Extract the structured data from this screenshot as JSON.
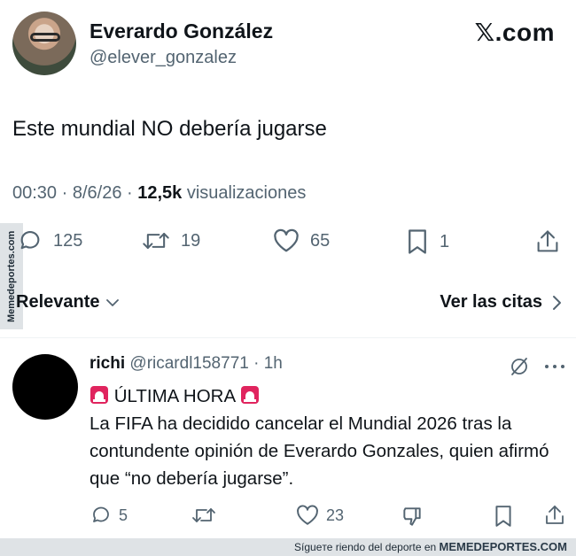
{
  "author": {
    "name": "Everardo González",
    "handle": "@elever_gonzalez"
  },
  "brand": "𝕏.com",
  "tweet": {
    "text": "Este mundial NO debería jugarse",
    "time": "00:30",
    "date": "8/6/26",
    "views_count": "12,5k",
    "views_label": "visualizaciones",
    "replies": "125",
    "retweets": "19",
    "likes": "65",
    "bookmarks": "1"
  },
  "filters": {
    "relevant_label": "Relevante",
    "quotes_label": "Ver las citas"
  },
  "side_watermark": "Memedeportes.com",
  "reply": {
    "name": "richi",
    "handle": "@ricardl158771",
    "time": "1h",
    "headline": "ÚLTIMA HORA",
    "body": "La FIFA ha decidido cancelar el Mundial 2026 tras la contundente opinión de Everardo Gonzales, quien afirmó que “no debería jugarse”.",
    "replies": "5",
    "likes": "23"
  },
  "footer": {
    "text": "Sígueте riendo del deporte en",
    "site": "MEMEDEPORTES.COM"
  },
  "colors": {
    "text": "#0f1419",
    "secondary": "#536471",
    "siren": "#e0245e",
    "watermark_bg": "#dfe3e6"
  },
  "icons": [
    "reply-icon",
    "retweet-icon",
    "like-icon",
    "bookmark-icon",
    "share-icon",
    "chevron-down-icon",
    "chevron-right-icon",
    "grok-icon",
    "more-icon",
    "dislike-icon",
    "siren-icon"
  ]
}
